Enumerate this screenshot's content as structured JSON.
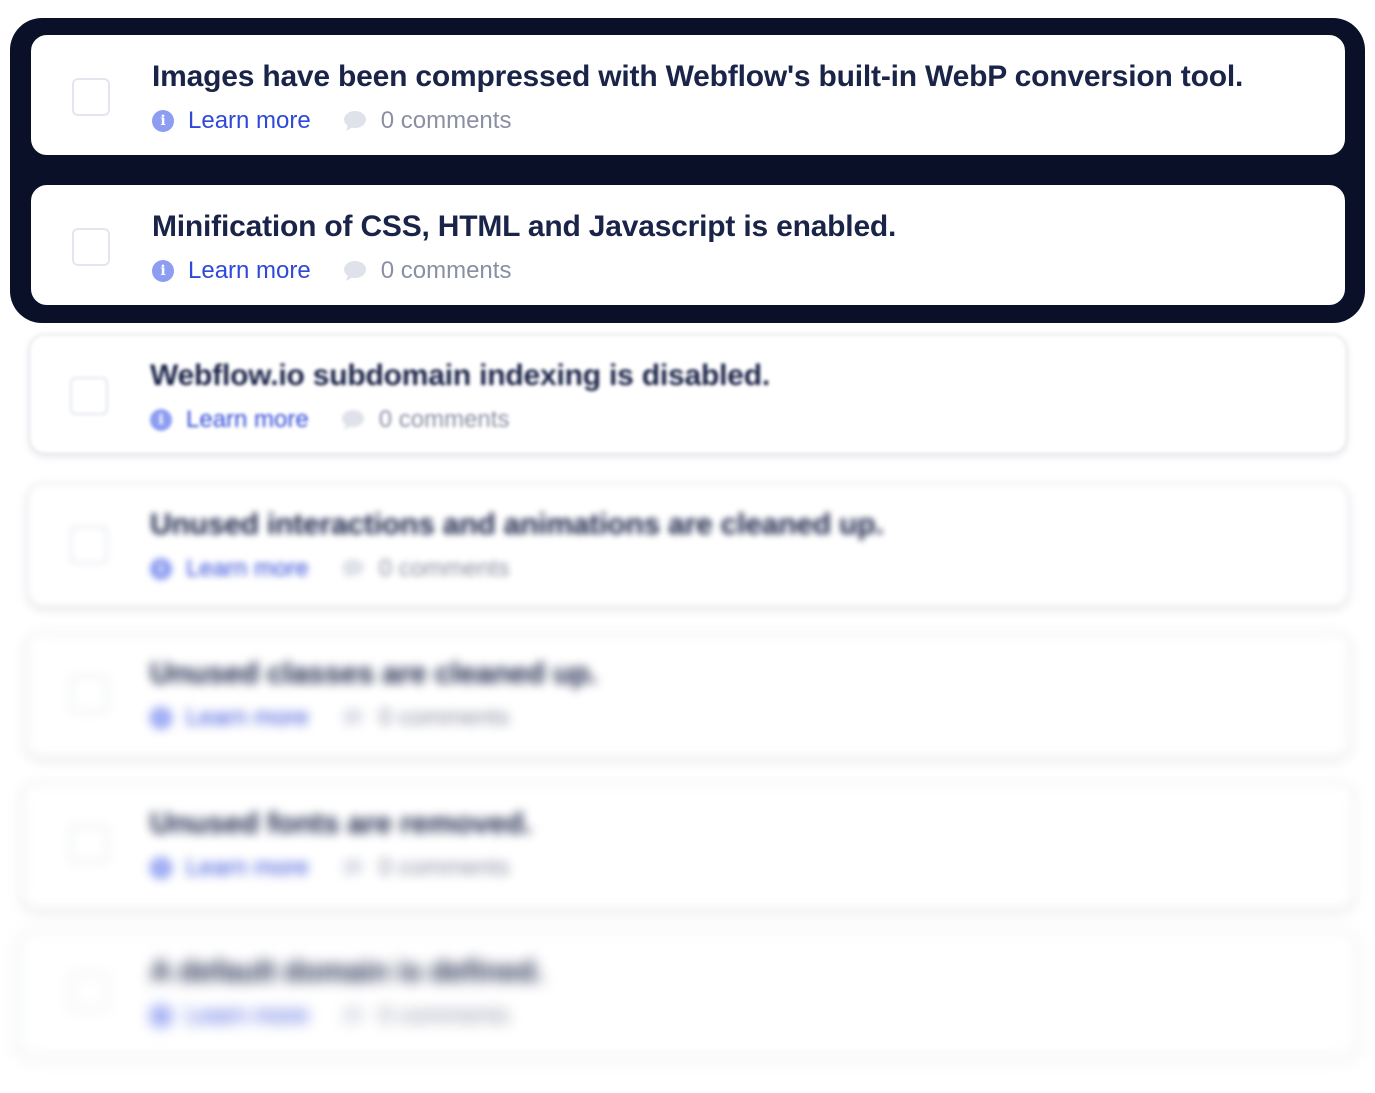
{
  "checklist": {
    "items": [
      {
        "title": "Images have been compressed with Webflow's built-in WebP conversion tool.",
        "learn_more": "Learn more",
        "comments": "0 comments"
      },
      {
        "title": "Minification of CSS, HTML and Javascript is enabled.",
        "learn_more": "Learn more",
        "comments": "0 comments"
      },
      {
        "title": "Webflow.io subdomain indexing is disabled.",
        "learn_more": "Learn more",
        "comments": "0 comments"
      },
      {
        "title": "Unused interactions and animations are cleaned up.",
        "learn_more": "Learn more",
        "comments": "0 comments"
      },
      {
        "title": "Unused classes are cleaned up.",
        "learn_more": "Learn more",
        "comments": "0 comments"
      },
      {
        "title": "Unused fonts are removed.",
        "learn_more": "Learn more",
        "comments": "0 comments"
      },
      {
        "title": "A default domain is defined.",
        "learn_more": "Learn more",
        "comments": "0 comments"
      }
    ]
  },
  "icons": {
    "info": "info-icon",
    "comment": "comment-bubble-icon",
    "checkbox": "checkbox-icon"
  },
  "colors": {
    "band_background": "#0a1028",
    "title_text": "#1a2348",
    "link": "#2f49d8",
    "info_icon": "#8d9df2",
    "muted_text": "#8a8fa3"
  }
}
